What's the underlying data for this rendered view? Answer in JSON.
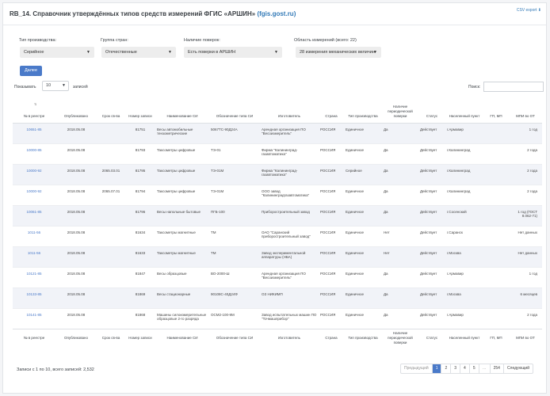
{
  "page": {
    "title": "RB_14. Справочник утверждённых типов средств измерений ФГИС «АРШИН»",
    "title_link": "(fgis.gost.ru)",
    "csv_export": "CSV export ⬇"
  },
  "filters": [
    {
      "label": "Тип производства:",
      "value": "Серийное"
    },
    {
      "label": "Группа стран:",
      "value": "Отечественные"
    },
    {
      "label": "Наличие поверок:",
      "value": "Есть поверки в АРШИН"
    },
    {
      "label": "Область измерений (всего: 22)",
      "value": "28 измерения механических величин"
    }
  ],
  "apply_button": "Далее",
  "length": {
    "show_label": "Показывать",
    "value": "10",
    "entries_label": "записей"
  },
  "search_label": "Поиск:",
  "columns": [
    "№ в реестре",
    "Опубликовано",
    "Срок св-ва",
    "Номер записи",
    "Наименование СИ",
    "Обозначение типа СИ",
    "Изготовитель",
    "Страна",
    "Тип производства",
    "Наличие периодической поверки",
    "Статус",
    "Населенный пункт",
    "ГП, МП",
    "МПИ во ОТ"
  ],
  "rows": [
    [
      "10651-85",
      "2018.05.08",
      "",
      "81751",
      "Весы автомобильные тензометрические",
      "5067ТС-90Д24А",
      "Арендная организация ПО \"Весоизмеритель\"",
      "РОССИЯ",
      "Единичное",
      "Да",
      "Действует",
      "г.Армавир",
      "",
      "1 год"
    ],
    [
      "10000-85",
      "2018.05.08",
      "",
      "81793",
      "Таксометры цифровые",
      "ТЭ-01",
      "Фирма \"Калининград-газавтоматика\"",
      "РОССИЯ",
      "Единичное",
      "Да",
      "Действует",
      "г.Калининград",
      "",
      "2 года"
    ],
    [
      "10000-92",
      "2018.05.08",
      "2065.03.01",
      "81795",
      "Таксометры цифровые",
      "ТЭ-01М",
      "Фирма \"Калининград-газавтоматика\"",
      "РОССИЯ",
      "Серийное",
      "Да",
      "Действует",
      "г.Калининград",
      "",
      "2 года"
    ],
    [
      "10000-92",
      "2018.05.08",
      "2065.07.01",
      "81794",
      "Таксометры цифровые",
      "ТЭ-01М",
      "ООО завод \"Калининградгазавтоматика\"",
      "РОССИЯ",
      "Единичное",
      "Да",
      "Действует",
      "г.Калининград",
      "",
      "2 года"
    ],
    [
      "10061-85",
      "2018.05.08",
      "",
      "81796",
      "Весы напольные бытовые",
      "ПГБ-100",
      "Приборостроительный завод",
      "РОССИЯ",
      "Единичное",
      "Да",
      "Действует",
      "г.Сосенский",
      "",
      "1 год (ГОСТ 8.062-71)"
    ],
    [
      "1011-56",
      "2018.05.08",
      "",
      "81634",
      "Таксометры магнитные",
      "ТМ",
      "ОАО \"Саранский приборостроительный завод\"",
      "РОССИЯ",
      "Единичное",
      "Нет",
      "Действует",
      "г.Саранск",
      "",
      "Нет данных"
    ],
    [
      "1011-56",
      "2018.05.08",
      "",
      "81633",
      "Таксометры магнитные",
      "ТМ",
      "Завод экспериментальной аппаратуры (НБА)",
      "РОССИЯ",
      "Единичное",
      "Нет",
      "Действует",
      "г.Москва",
      "",
      "Нет данных"
    ],
    [
      "10121-85",
      "2018.05.08",
      "",
      "81847",
      "Весы образцовые",
      "ВО-2000-Ш",
      "Арендная организация ПО \"Весоизмеритель\"",
      "РОССИЯ",
      "Единичное",
      "Да",
      "Действует",
      "г.Армавир",
      "",
      "1 год"
    ],
    [
      "10133-85",
      "2018.05.08",
      "",
      "81869",
      "Весы стационарные",
      "90108С-40Д24Ф",
      "ОЗ НИКИМП",
      "РОССИЯ",
      "Единичное",
      "Да",
      "Действует",
      "г.Москва",
      "",
      "6 месяцев"
    ],
    [
      "10141-85",
      "2018.05.08",
      "",
      "81868",
      "Машины силоизмерительные образцовые 2-го разряда",
      "ОСМ2-100-9М",
      "Завод испытательных машин ПО \"Точмашприбор\"",
      "РОССИЯ",
      "Единичное",
      "Да",
      "Действует",
      "г.Армавир",
      "",
      "2 года"
    ]
  ],
  "info": "Записи с 1 по 10, всего записей: 2,532",
  "pagination": {
    "prev": "Предыдущий",
    "pages": [
      "1",
      "2",
      "3",
      "4",
      "5",
      "…",
      "254"
    ],
    "next": "Следующий",
    "active": "1"
  },
  "colors": {
    "accent": "#4a7ac9",
    "link": "#337ab7",
    "stripe": "#f1f3f8"
  }
}
